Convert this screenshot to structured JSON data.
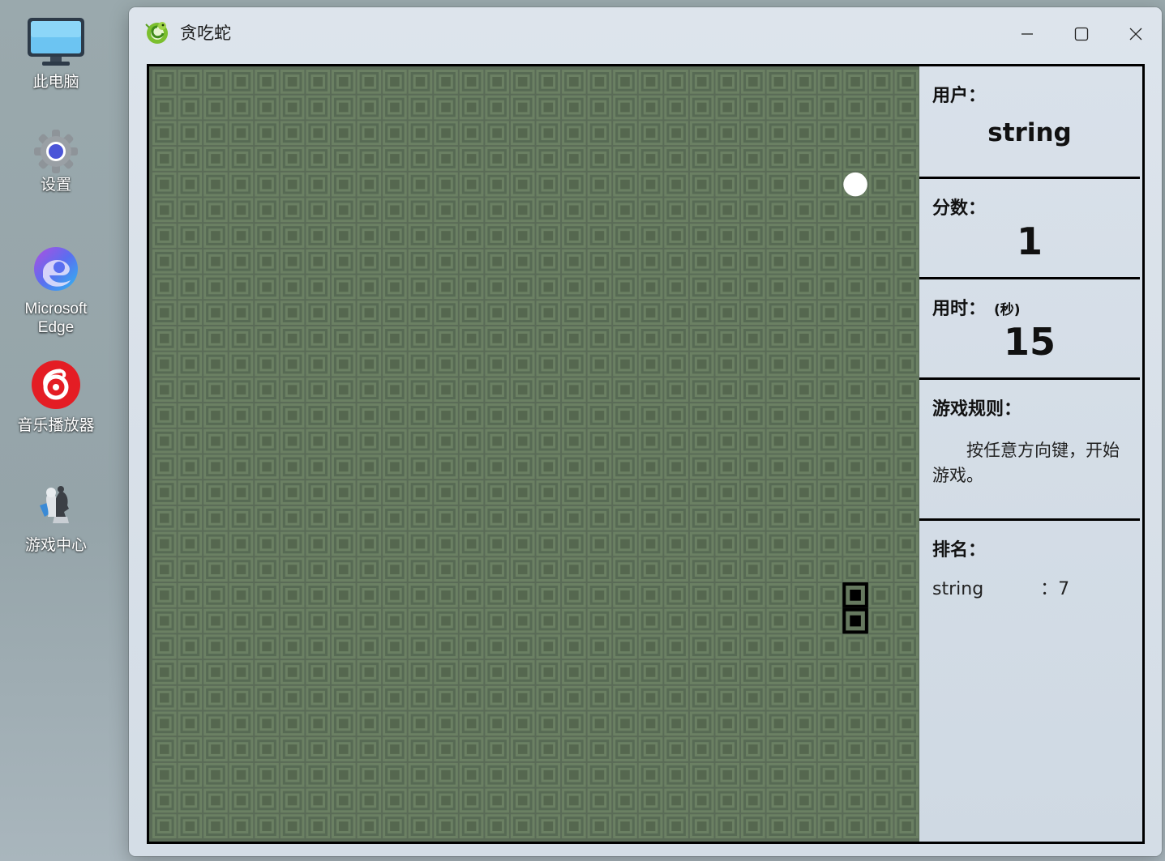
{
  "desktop": {
    "icons": [
      {
        "label": "此电脑",
        "icon": "monitor-icon"
      },
      {
        "label": "设置",
        "icon": "gear-icon"
      },
      {
        "label": "Microsoft\nEdge",
        "icon": "edge-icon"
      },
      {
        "label": "音乐播放器",
        "icon": "music-player-icon"
      },
      {
        "label": "游戏中心",
        "icon": "game-center-icon"
      }
    ]
  },
  "window": {
    "title": "贪吃蛇",
    "app_icon": "snake-app-icon",
    "controls": {
      "minimize": "minimize-icon",
      "maximize": "maximize-icon",
      "close": "close-icon"
    }
  },
  "board": {
    "grid_cols": 30,
    "grid_rows": 30,
    "food": {
      "col": 27,
      "row": 4
    },
    "snake": [
      {
        "col": 27,
        "row": 20
      },
      {
        "col": 27,
        "row": 21
      }
    ],
    "colors": {
      "tile": "#5d7259",
      "snake": "#000000",
      "food": "#ffffff"
    }
  },
  "panel": {
    "user_label": "用户：",
    "user_value": "string",
    "score_label": "分数：",
    "score_value": "1",
    "time_label": "用时：",
    "time_unit": "(秒)",
    "time_value": "15",
    "rules_label": "游戏规则：",
    "rules_text": "按任意方向键，开始游戏。",
    "rank_label": "排名：",
    "rank_rows": [
      {
        "name": "string",
        "sep": "：",
        "score": "7"
      }
    ]
  }
}
